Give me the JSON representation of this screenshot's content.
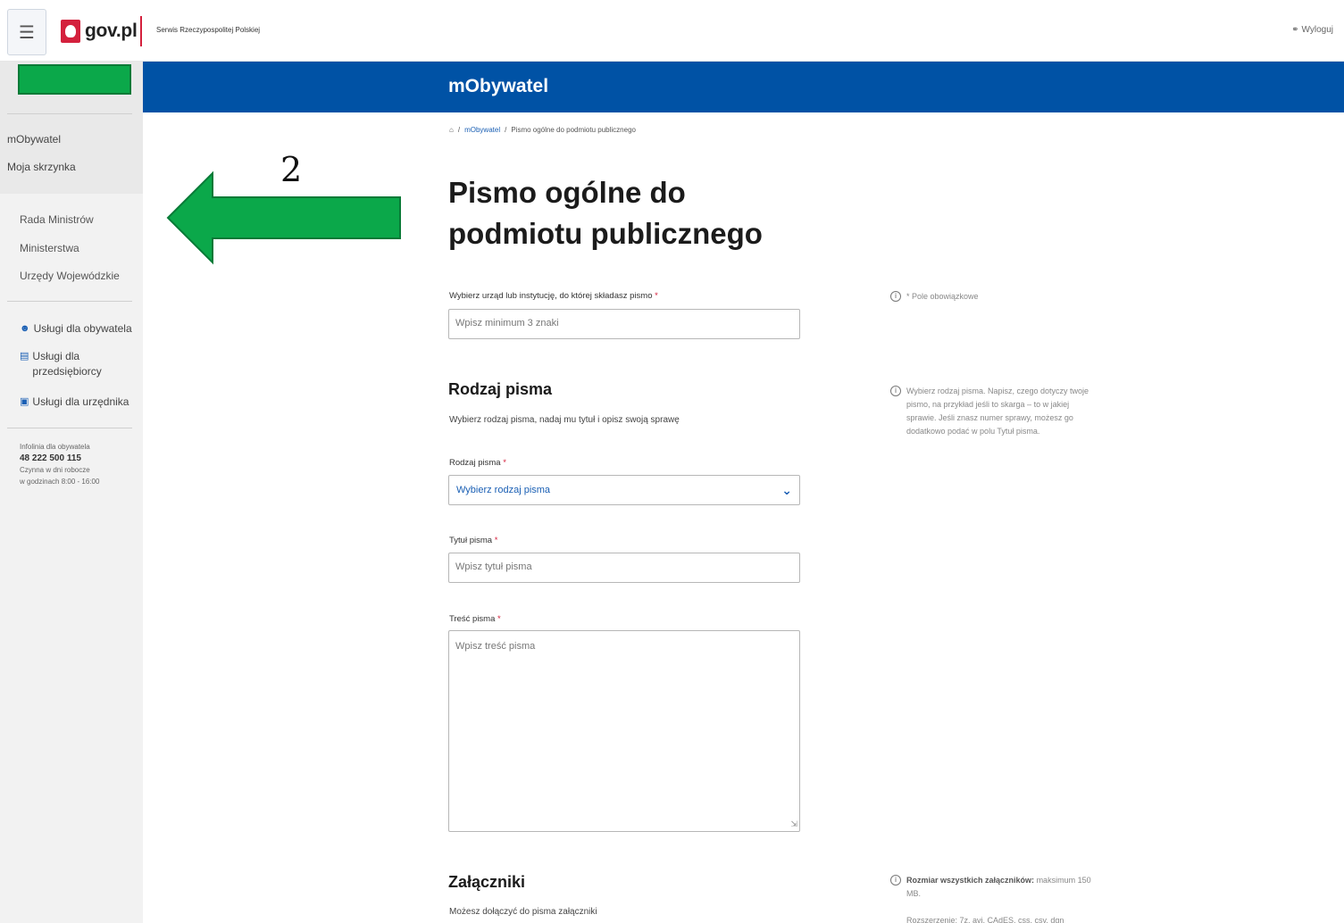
{
  "header": {
    "menu_icon": "hamburger-icon",
    "logo_text": "gov.pl",
    "service_name": "Serwis Rzeczypospolitej Polskiej",
    "logout_label": "Wyloguj"
  },
  "sidebar": {
    "top_links": [
      "mObywatel",
      "Moja skrzynka"
    ],
    "gov_links": [
      "Rada Ministrów",
      "Ministerstwa",
      "Urzędy Wojewódzkie"
    ],
    "services": [
      {
        "icon": "person-icon",
        "label": "Usługi dla obywatela"
      },
      {
        "icon": "briefcase-icon",
        "label": "Usługi dla przedsiębiorcy"
      },
      {
        "icon": "monitor-icon",
        "label": "Usługi dla urzędnika"
      }
    ],
    "infoline": {
      "label": "Infolinia dla obywatela",
      "phone": "48 222 500 115",
      "hours_line1": "Czynna w dni robocze",
      "hours_line2": "w godzinach 8:00 - 16:00"
    }
  },
  "band": {
    "title": "mObywatel"
  },
  "breadcrumb": {
    "home_icon": "home-icon",
    "items": [
      "mObywatel",
      "Pismo ogólne do podmiotu publicznego"
    ]
  },
  "page": {
    "title": "Pismo ogólne do podmiotu publicznego"
  },
  "form": {
    "institution": {
      "label": "Wybierz urząd lub instytucję, do której składasz pismo",
      "required_mark": "*",
      "placeholder": "Wpisz minimum 3 znaki"
    },
    "required_hint": "* Pole obowiązkowe",
    "letter_type_section": {
      "title": "Rodzaj pisma",
      "description": "Wybierz rodzaj pisma, nadaj mu tytuł i opisz swoją sprawę",
      "hint": "Wybierz rodzaj pisma. Napisz, czego dotyczy twoje pismo, na przykład jeśli to skarga – to w jakiej sprawie. Jeśli znasz numer sprawy, możesz go dodatkowo podać w polu Tytuł pisma."
    },
    "letter_type": {
      "label": "Rodzaj pisma",
      "required_mark": "*",
      "selected": "Wybierz rodzaj pisma"
    },
    "letter_title": {
      "label": "Tytuł pisma",
      "required_mark": "*",
      "placeholder": "Wpisz tytuł pisma"
    },
    "letter_body": {
      "label": "Treść pisma",
      "required_mark": "*",
      "placeholder": "Wpisz treść pisma"
    },
    "attachments": {
      "title": "Załączniki",
      "description": "Możesz dołączyć do pisma załączniki",
      "hint_bold": "Rozmiar wszystkich załączników:",
      "hint_text": "maksimum 150 MB.",
      "hint2": "Rozszerzenie: 7z, avi, CAdES, css, csv, dgn"
    }
  },
  "annotation": {
    "number": "2",
    "arrow_color": "#0ba84a"
  }
}
